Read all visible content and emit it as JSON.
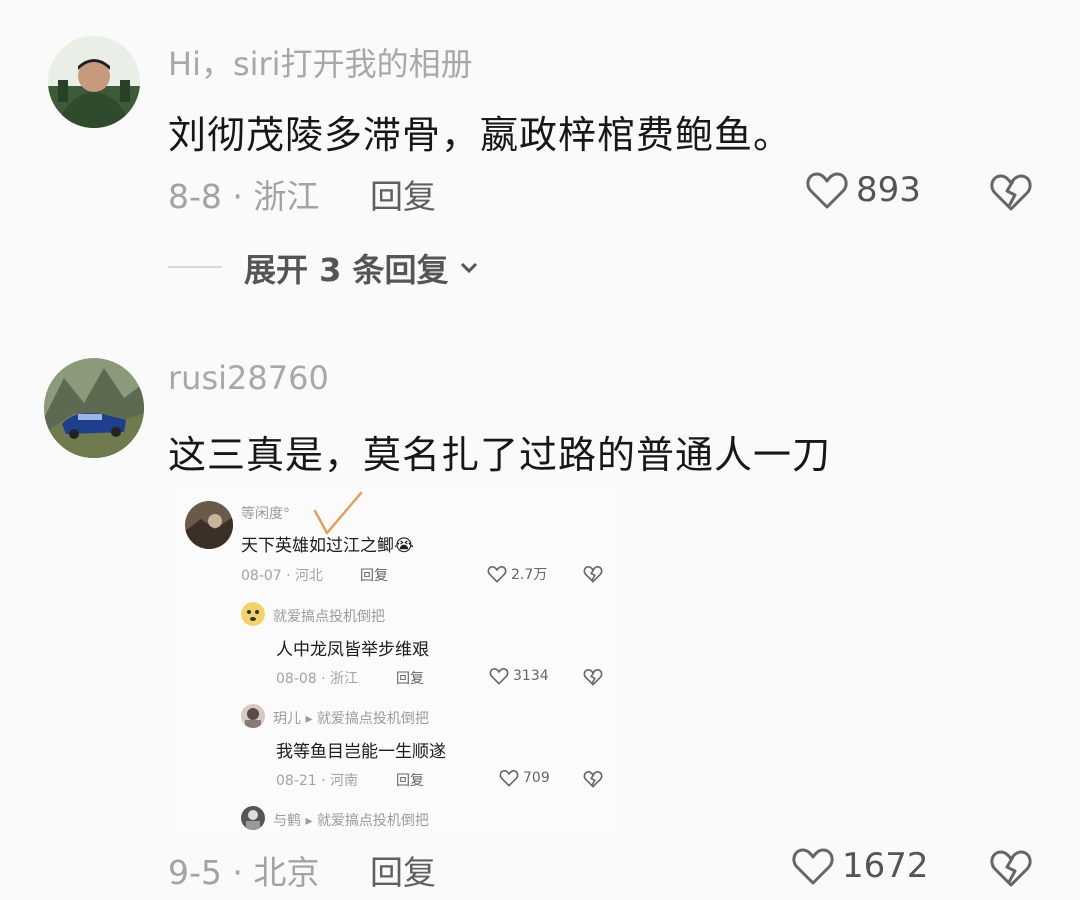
{
  "comments": [
    {
      "username": "Hi，siri打开我的相册",
      "text": "刘彻茂陵多滞骨，嬴政梓棺费鲍鱼。",
      "date_location": "8-8 · 浙江",
      "reply_label": "回复",
      "likes": "893",
      "expand_replies": "展开 3 条回复"
    },
    {
      "username": "rusi28760",
      "text": "这三真是，莫名扎了过路的普通人一刀",
      "date_location": "9-5 · 北京",
      "reply_label": "回复",
      "likes": "1672"
    }
  ],
  "embedded_screenshot": {
    "main": {
      "username": "等闲度°",
      "text": "天下英雄如过江之鲫",
      "emoji": "😭",
      "date": "08-07",
      "location": "河北",
      "reply_label": "回复",
      "likes": "2.7万"
    },
    "replies": [
      {
        "username": "就爱搞点投机倒把",
        "text": "人中龙凤皆举步维艰",
        "date": "08-08",
        "location": "浙江",
        "reply_label": "回复",
        "likes": "3134"
      },
      {
        "username": "玥儿",
        "reply_to": "就爱搞点投机倒把",
        "text": "我等鱼目岂能一生顺遂",
        "date": "08-21",
        "location": "河南",
        "reply_label": "回复",
        "likes": "709"
      },
      {
        "username": "与鹤",
        "reply_to": "就爱搞点投机倒把"
      }
    ]
  },
  "colors": {
    "background": "#fafafa",
    "muted_text": "#a3a3a3",
    "annotation_check": "#e0a060"
  }
}
